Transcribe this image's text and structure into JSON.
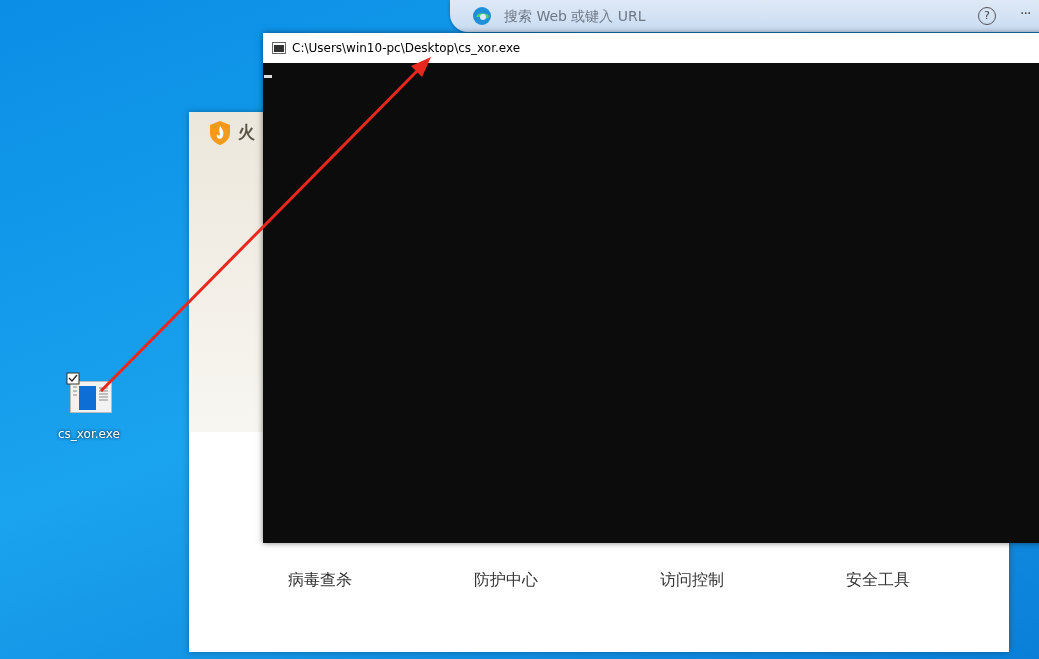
{
  "browser_bar": {
    "search": {
      "placeholder": "搜索 Web 或键入 URL"
    },
    "help": "?",
    "more": "···"
  },
  "desktop_icon": {
    "label": "cs_xor.exe",
    "checked": true
  },
  "security_window": {
    "title": "火",
    "nav": [
      "病毒查杀",
      "防护中心",
      "访问控制",
      "安全工具"
    ]
  },
  "console_window": {
    "title": "C:\\Users\\win10-pc\\Desktop\\cs_xor.exe"
  }
}
